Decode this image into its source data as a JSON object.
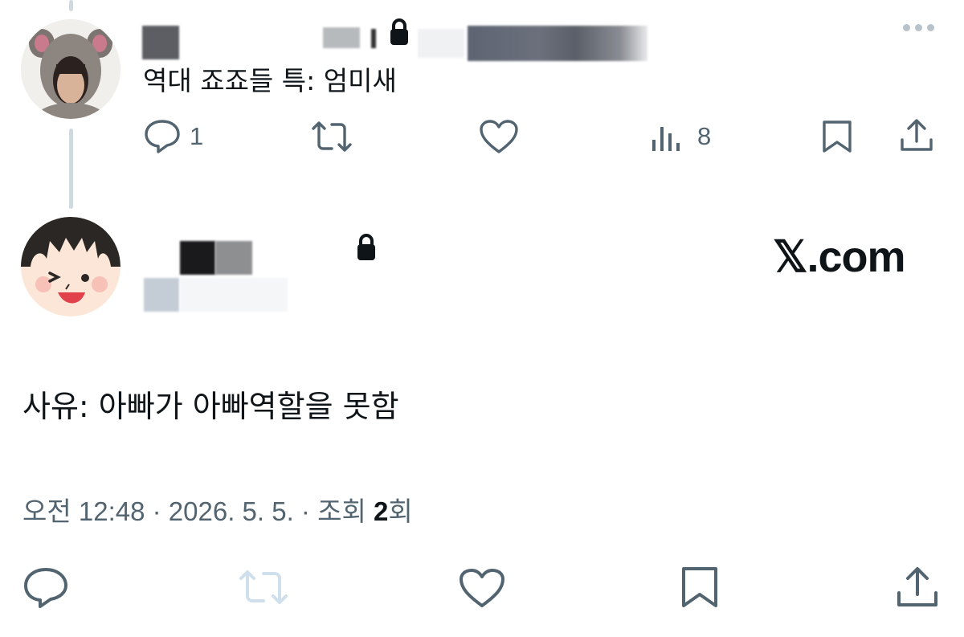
{
  "parent_tweet": {
    "text": "역대 죠죠들 특: 엄미새",
    "actions": {
      "reply_count": "1",
      "views_count": "8"
    }
  },
  "main_tweet": {
    "text": "사유: 아빠가 아빠역할을 못함",
    "timestamp": "오전 12:48 · 2026. 5. 5. · 조회 ",
    "views_value": "2",
    "views_suffix": "회"
  },
  "brand": {
    "label": "𝕏.com"
  },
  "colors": {
    "text": "#0f1419",
    "secondary": "#536471",
    "thread_line": "#cfd9de",
    "retweet_disabled": "#cfe0ec"
  },
  "icons": [
    "more-icon",
    "lock-icon",
    "reply-icon",
    "retweet-icon",
    "like-icon",
    "views-icon",
    "bookmark-icon",
    "share-icon"
  ]
}
